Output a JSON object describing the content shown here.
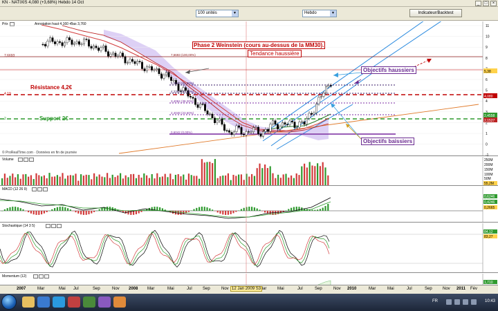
{
  "window": {
    "title": "KN - NATIXIS   4,080 (+3,68%)   Hebdo  14 Oct"
  },
  "toolbar": {
    "units_select": "100 unités",
    "period_select": "Hebdo",
    "indicator_button": "Indicateur/Backtest"
  },
  "price_panel": {
    "name": "Prix",
    "info": "Annotation haut 4,160 •Bas 3,760",
    "copyright": "© ProRealTime.com · Données en fin de journée",
    "y_ticks": [
      "11",
      "10",
      "9",
      "8",
      "7",
      "6",
      "5",
      "4",
      "3",
      "2",
      "1",
      "0",
      "-1"
    ],
    "last_price_label": "4,080",
    "axis_badges": [
      "5,38",
      "2,4558",
      "2,1527"
    ],
    "levels": {
      "top_value": "7,6693",
      "top_fib": "7,6693 (100,00%)",
      "fib_618": "5,0860 (61,80%)",
      "fib_50": "4,2367 (50,00%)",
      "fib_382": "3,4084 (38,20%)",
      "fib_236": "2,4048 (23,60%)",
      "fib_0": "0,6042 (0,00%)",
      "resistance_value": "4,19",
      "support_value": "2"
    },
    "annotations": {
      "phase2": "Phase 2 Weinstein (cours au-dessus de la MM30).",
      "trend": "Tendance haussière",
      "resistance": "Résistance 4,2€",
      "support": "Support  2€",
      "upside": "Objectifs haussiers",
      "downside": "Objectifs baissiers"
    },
    "colors": {
      "resistance": "#c00000",
      "support": "#2e9a2e",
      "fib_top": "#8b1a1a",
      "fib_mid": "#3a1a6a",
      "fib_bottom": "#7a2aa0",
      "cloud": "#d7c8f3",
      "mm30": "#d23b3b",
      "mm_fast": "#2a7a2a",
      "channel": "#2a8adf",
      "trendline": "#e07a2a",
      "candles": "#000000"
    }
  },
  "volume_panel": {
    "name": "Volume",
    "y_ticks": [
      "250M",
      "200M",
      "150M",
      "100M",
      "50M"
    ],
    "last_label": "55,2M"
  },
  "macd_panel": {
    "name": "MACD (12 26 9)",
    "y_ticks": [
      "0,6246",
      "0,4246",
      "0,2665"
    ]
  },
  "stoch_panel": {
    "name": "Stochastique (14 3 5)",
    "y_ticks": [
      "84,12",
      "83,27"
    ]
  },
  "momentum_panel": {
    "name": "Momentum (12)",
    "y_ticks": [
      "1,710"
    ]
  },
  "x_axis": {
    "labels": [
      {
        "text": "2007",
        "year": true
      },
      {
        "text": "Mar",
        "year": false
      },
      {
        "text": "Mai",
        "year": false
      },
      {
        "text": "Jul",
        "year": false
      },
      {
        "text": "Sep",
        "year": false
      },
      {
        "text": "Nov",
        "year": false
      },
      {
        "text": "2008",
        "year": true
      },
      {
        "text": "Mar",
        "year": false
      },
      {
        "text": "Mai",
        "year": false
      },
      {
        "text": "Jul",
        "year": false
      },
      {
        "text": "Sep",
        "year": false
      },
      {
        "text": "Nov",
        "year": false
      },
      {
        "text": "Mar",
        "year": false
      },
      {
        "text": "Mai",
        "year": false
      },
      {
        "text": "Jul",
        "year": false
      },
      {
        "text": "Sep",
        "year": false
      },
      {
        "text": "Nov",
        "year": false
      },
      {
        "text": "2010",
        "year": true
      },
      {
        "text": "Mar",
        "year": false
      },
      {
        "text": "Mai",
        "year": false
      },
      {
        "text": "Jul",
        "year": false
      },
      {
        "text": "Sep",
        "year": false
      },
      {
        "text": "Nov",
        "year": false
      },
      {
        "text": "2011",
        "year": true
      },
      {
        "text": "Fév",
        "year": false
      }
    ],
    "cursor_label": "12 Jan 2009 S3"
  },
  "taskbar": {
    "language": "FR",
    "clock": "10:43"
  }
}
